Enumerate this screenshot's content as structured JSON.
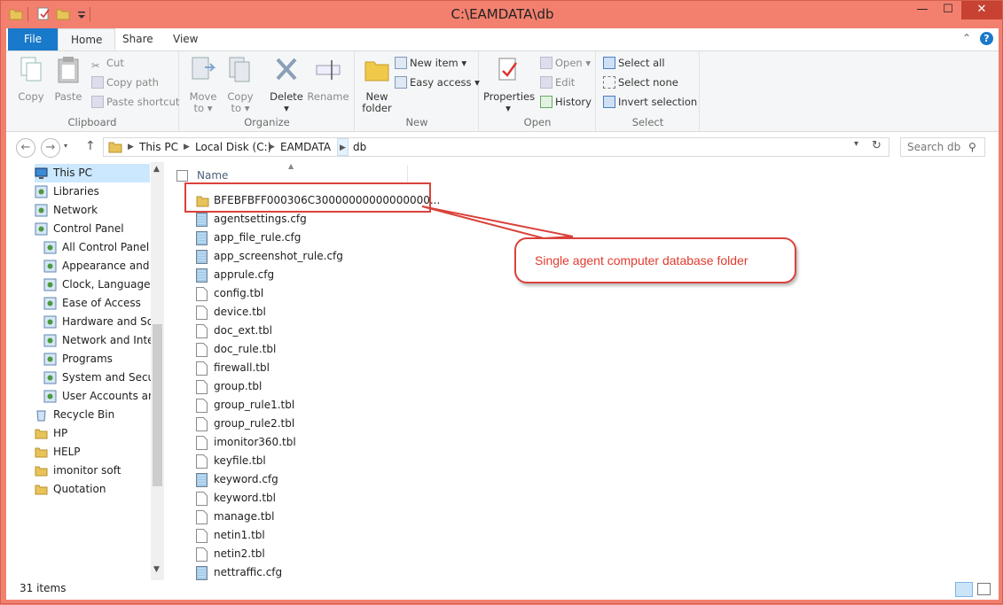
{
  "window": {
    "title": "C:\\EAMDATA\\db",
    "minimize": "—",
    "maximize": "☐",
    "close": "✕"
  },
  "ribbon": {
    "tabs": [
      "File",
      "Home",
      "Share",
      "View"
    ],
    "clipboard": {
      "label": "Clipboard",
      "copy": "Copy",
      "paste": "Paste",
      "cut": "Cut",
      "copy_path": "Copy path",
      "paste_shortcut": "Paste shortcut"
    },
    "organize": {
      "label": "Organize",
      "move_to": "Move",
      "move_to2": "to",
      "copy_to": "Copy",
      "copy_to2": "to",
      "delete": "Delete",
      "rename": "Rename"
    },
    "new": {
      "label": "New",
      "new_folder": "New",
      "new_folder2": "folder",
      "new_item": "New item",
      "easy_access": "Easy access"
    },
    "open": {
      "label": "Open",
      "properties": "Properties",
      "open": "Open",
      "edit": "Edit",
      "history": "History"
    },
    "select": {
      "label": "Select",
      "select_all": "Select all",
      "select_none": "Select none",
      "invert_selection": "Invert selection"
    }
  },
  "address": {
    "breadcrumbs": [
      "This PC",
      "Local Disk (C:)",
      "EAMDATA",
      "db"
    ],
    "search_placeholder": "Search db"
  },
  "nav": {
    "items": [
      {
        "label": "This PC",
        "icon": "computer-icon"
      },
      {
        "label": "Libraries",
        "icon": "libraries-icon"
      },
      {
        "label": "Network",
        "icon": "network-icon"
      },
      {
        "label": "Control Panel",
        "icon": "control-panel-icon"
      },
      {
        "label": "All Control Panel It",
        "icon": "control-panel-icon"
      },
      {
        "label": "Appearance and Pe",
        "icon": "appearance-icon"
      },
      {
        "label": "Clock, Language, a",
        "icon": "clock-icon"
      },
      {
        "label": "Ease of Access",
        "icon": "ease-access-icon"
      },
      {
        "label": "Hardware and Sou",
        "icon": "hardware-icon"
      },
      {
        "label": "Network and Interr",
        "icon": "network-internet-icon"
      },
      {
        "label": "Programs",
        "icon": "programs-icon"
      },
      {
        "label": "System and Securit",
        "icon": "security-icon"
      },
      {
        "label": "User Accounts and",
        "icon": "user-accounts-icon"
      },
      {
        "label": "Recycle Bin",
        "icon": "recycle-bin-icon"
      },
      {
        "label": "HP",
        "icon": "folder-icon"
      },
      {
        "label": "HELP",
        "icon": "folder-icon"
      },
      {
        "label": "imonitor soft",
        "icon": "folder-icon"
      },
      {
        "label": "Quotation",
        "icon": "folder-icon"
      }
    ]
  },
  "list": {
    "column_name": "Name",
    "files": [
      {
        "name": "BFEBFBFF000306C30000000000000000...",
        "type": "folder"
      },
      {
        "name": "agentsettings.cfg",
        "type": "cfg"
      },
      {
        "name": "app_file_rule.cfg",
        "type": "cfg"
      },
      {
        "name": "app_screenshot_rule.cfg",
        "type": "cfg"
      },
      {
        "name": "apprule.cfg",
        "type": "cfg"
      },
      {
        "name": "config.tbl",
        "type": "tbl"
      },
      {
        "name": "device.tbl",
        "type": "tbl"
      },
      {
        "name": "doc_ext.tbl",
        "type": "tbl"
      },
      {
        "name": "doc_rule.tbl",
        "type": "tbl"
      },
      {
        "name": "firewall.tbl",
        "type": "tbl"
      },
      {
        "name": "group.tbl",
        "type": "tbl"
      },
      {
        "name": "group_rule1.tbl",
        "type": "tbl"
      },
      {
        "name": "group_rule2.tbl",
        "type": "tbl"
      },
      {
        "name": "imonitor360.tbl",
        "type": "tbl"
      },
      {
        "name": "keyfile.tbl",
        "type": "tbl"
      },
      {
        "name": "keyword.cfg",
        "type": "cfg"
      },
      {
        "name": "keyword.tbl",
        "type": "tbl"
      },
      {
        "name": "manage.tbl",
        "type": "tbl"
      },
      {
        "name": "netin1.tbl",
        "type": "tbl"
      },
      {
        "name": "netin2.tbl",
        "type": "tbl"
      },
      {
        "name": "nettraffic.cfg",
        "type": "cfg"
      }
    ]
  },
  "status": {
    "item_count": "31 items"
  },
  "annotation": {
    "callout_text": "Single agent computer database folder"
  },
  "colors": {
    "frame": "#f3806f",
    "file_tab": "#1979ca",
    "annotation": "#d9423b"
  }
}
